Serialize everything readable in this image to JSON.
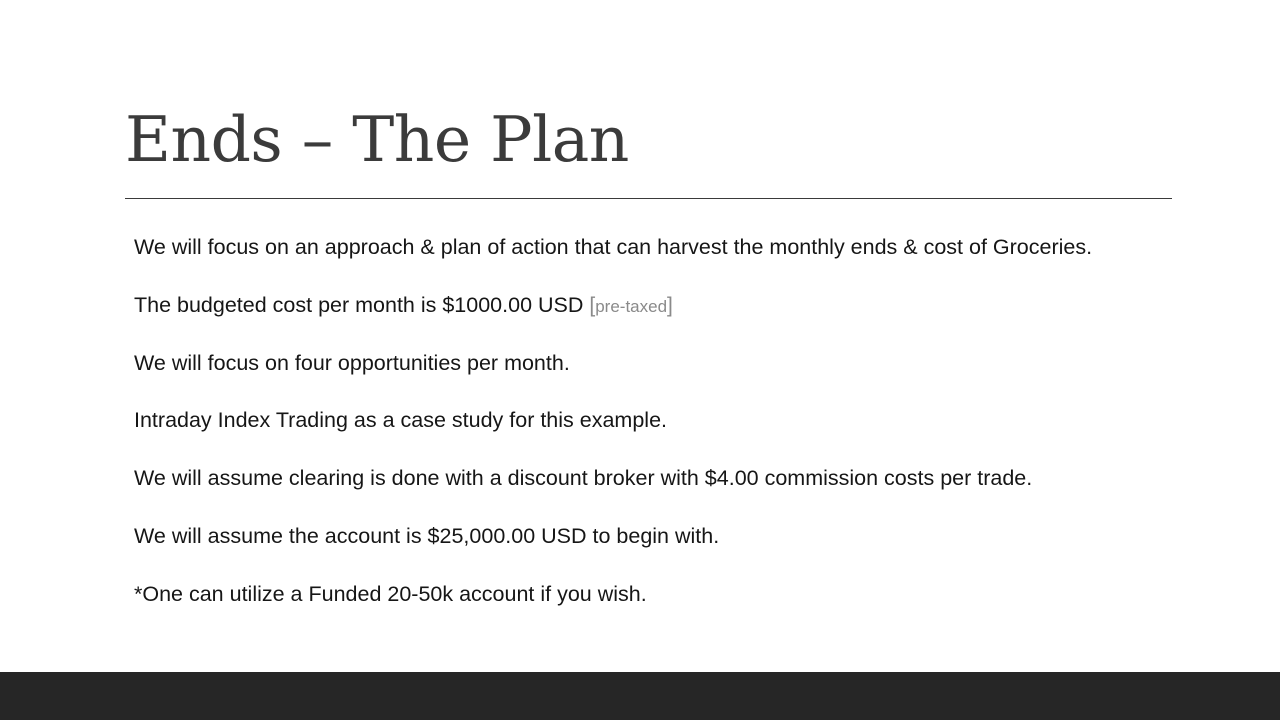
{
  "slide": {
    "title": "Ends – The Plan",
    "bullets": [
      "We will focus on an approach & plan of action that can harvest the monthly ends & cost of Groceries.",
      "The budgeted cost per month is $1000.00 USD",
      "We will focus on four opportunities per month.",
      "Intraday Index Trading as a case study for this example.",
      "We will assume clearing is done with a discount broker with $4.00 commission costs per trade.",
      "We will assume the account is $25,000.00 USD to begin with.",
      "*One can utilize a Funded 20-50k account if you wish."
    ],
    "budget_note": {
      "open_bracket": "[",
      "text": "pre-taxed",
      "close_bracket": "]"
    }
  },
  "colors": {
    "title": "#3b3b3b",
    "body_text": "#161616",
    "note_text": "#8a8a8a",
    "footer_bar": "#262626",
    "background": "#ffffff"
  }
}
